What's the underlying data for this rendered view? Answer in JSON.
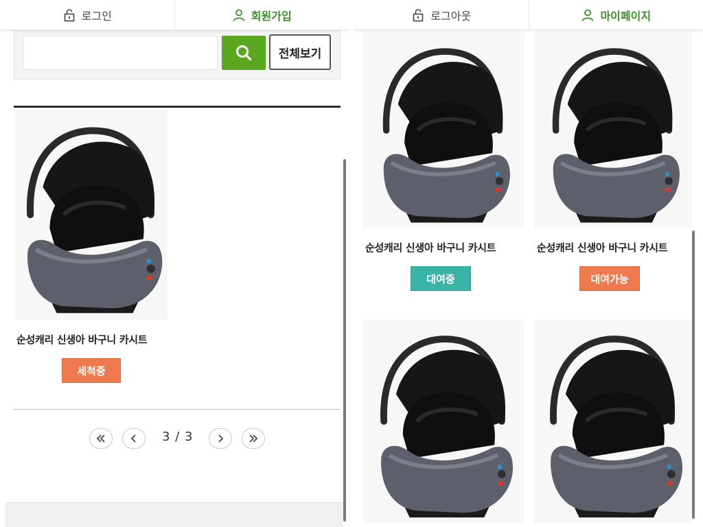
{
  "left": {
    "topbar": {
      "login_label": "로그인",
      "signup_label": "회원가입"
    },
    "search": {
      "value": "",
      "placeholder": "",
      "all_button_label": "전체보기"
    },
    "product": {
      "name": "순성캐리 신생아 바구니 카시트",
      "status": "세척중"
    },
    "pagination": {
      "page_text": "3 / 3"
    }
  },
  "right": {
    "topbar": {
      "logout_label": "로그아웃",
      "mypage_label": "마이페이지"
    },
    "products": [
      {
        "name": "순성캐리 신생아 바구니 카시트",
        "status": "대여중"
      },
      {
        "name": "순성캐리 신생아 바구니 카시트",
        "status": "대여가능"
      }
    ]
  },
  "icons": {
    "lock": "lock-icon",
    "user": "user-icon",
    "search": "search-icon",
    "first": "double-chevron-left-icon",
    "prev": "chevron-left-icon",
    "next": "chevron-right-icon",
    "last": "double-chevron-right-icon"
  },
  "colors": {
    "green": "#5aa71f",
    "green_text": "#3e8e2a",
    "status_orange": "#f07a4f",
    "status_teal": "#3ab3a6"
  }
}
